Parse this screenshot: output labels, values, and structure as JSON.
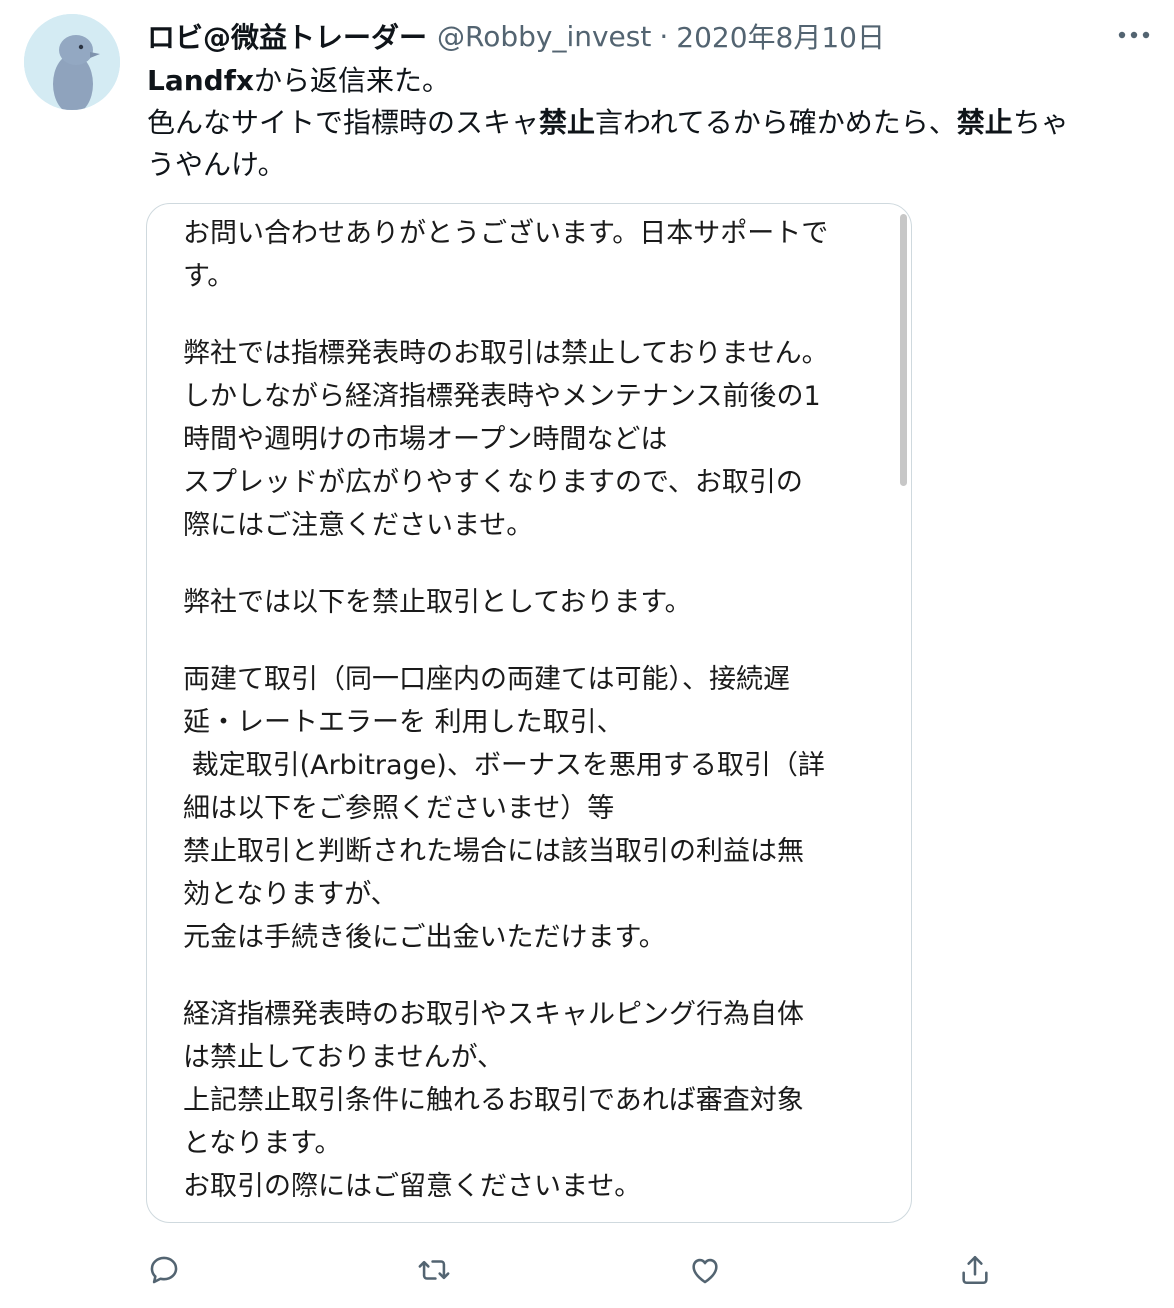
{
  "author": {
    "name": "ロビ@微益トレーダー",
    "handle": "@Robby_invest",
    "separator": "·",
    "date": "2020年8月10日"
  },
  "tweet": {
    "line1_bold": "Landfx",
    "line1_rest": "から返信来た。",
    "line2_part1": "色んなサイトで指標時のスキャ",
    "line2_bold1": "禁止",
    "line2_part2": "言われてるから確かめたら、",
    "line2_bold2": "禁止",
    "line2_part3": "ちゃ",
    "line3": "うやんけ。"
  },
  "reply_image": {
    "lines": [
      "お問い合わせありがとうございます。日本サポートで",
      "す。",
      "弊社では指標発表時のお取引は禁止しておりません。",
      "しかしながら経済指標発表時やメンテナンス前後の1",
      "時間や週明けの市場オープン時間などは",
      "スプレッドが広がりやすくなりますので、お取引の",
      "際にはご注意くださいませ。",
      "弊社では以下を禁止取引としております。",
      "両建て取引（同一口座内の両建ては可能）、接続遅",
      "延・レートエラーを 利用した取引、",
      " 裁定取引(Arbitrage)、ボーナスを悪用する取引（詳",
      "細は以下をご参照くださいませ）等",
      "禁止取引と判断された場合には該当取引の利益は無",
      "効となりますが、",
      "元金は手続き後にご出金いただけます。",
      "経済指標発表時のお取引やスキャルピング行為自体",
      "は禁止しておりませんが、",
      "上記禁止取引条件に触れるお取引であれば審査対象",
      "となります。",
      "お取引の際にはご留意くださいませ。"
    ]
  },
  "icons": {
    "more": "more-dots-icon",
    "reply": "reply-icon",
    "retweet": "retweet-icon",
    "like": "like-heart-icon",
    "share": "share-icon"
  },
  "colors": {
    "text": "#0f1419",
    "muted": "#536471",
    "border": "#cfd9de"
  }
}
